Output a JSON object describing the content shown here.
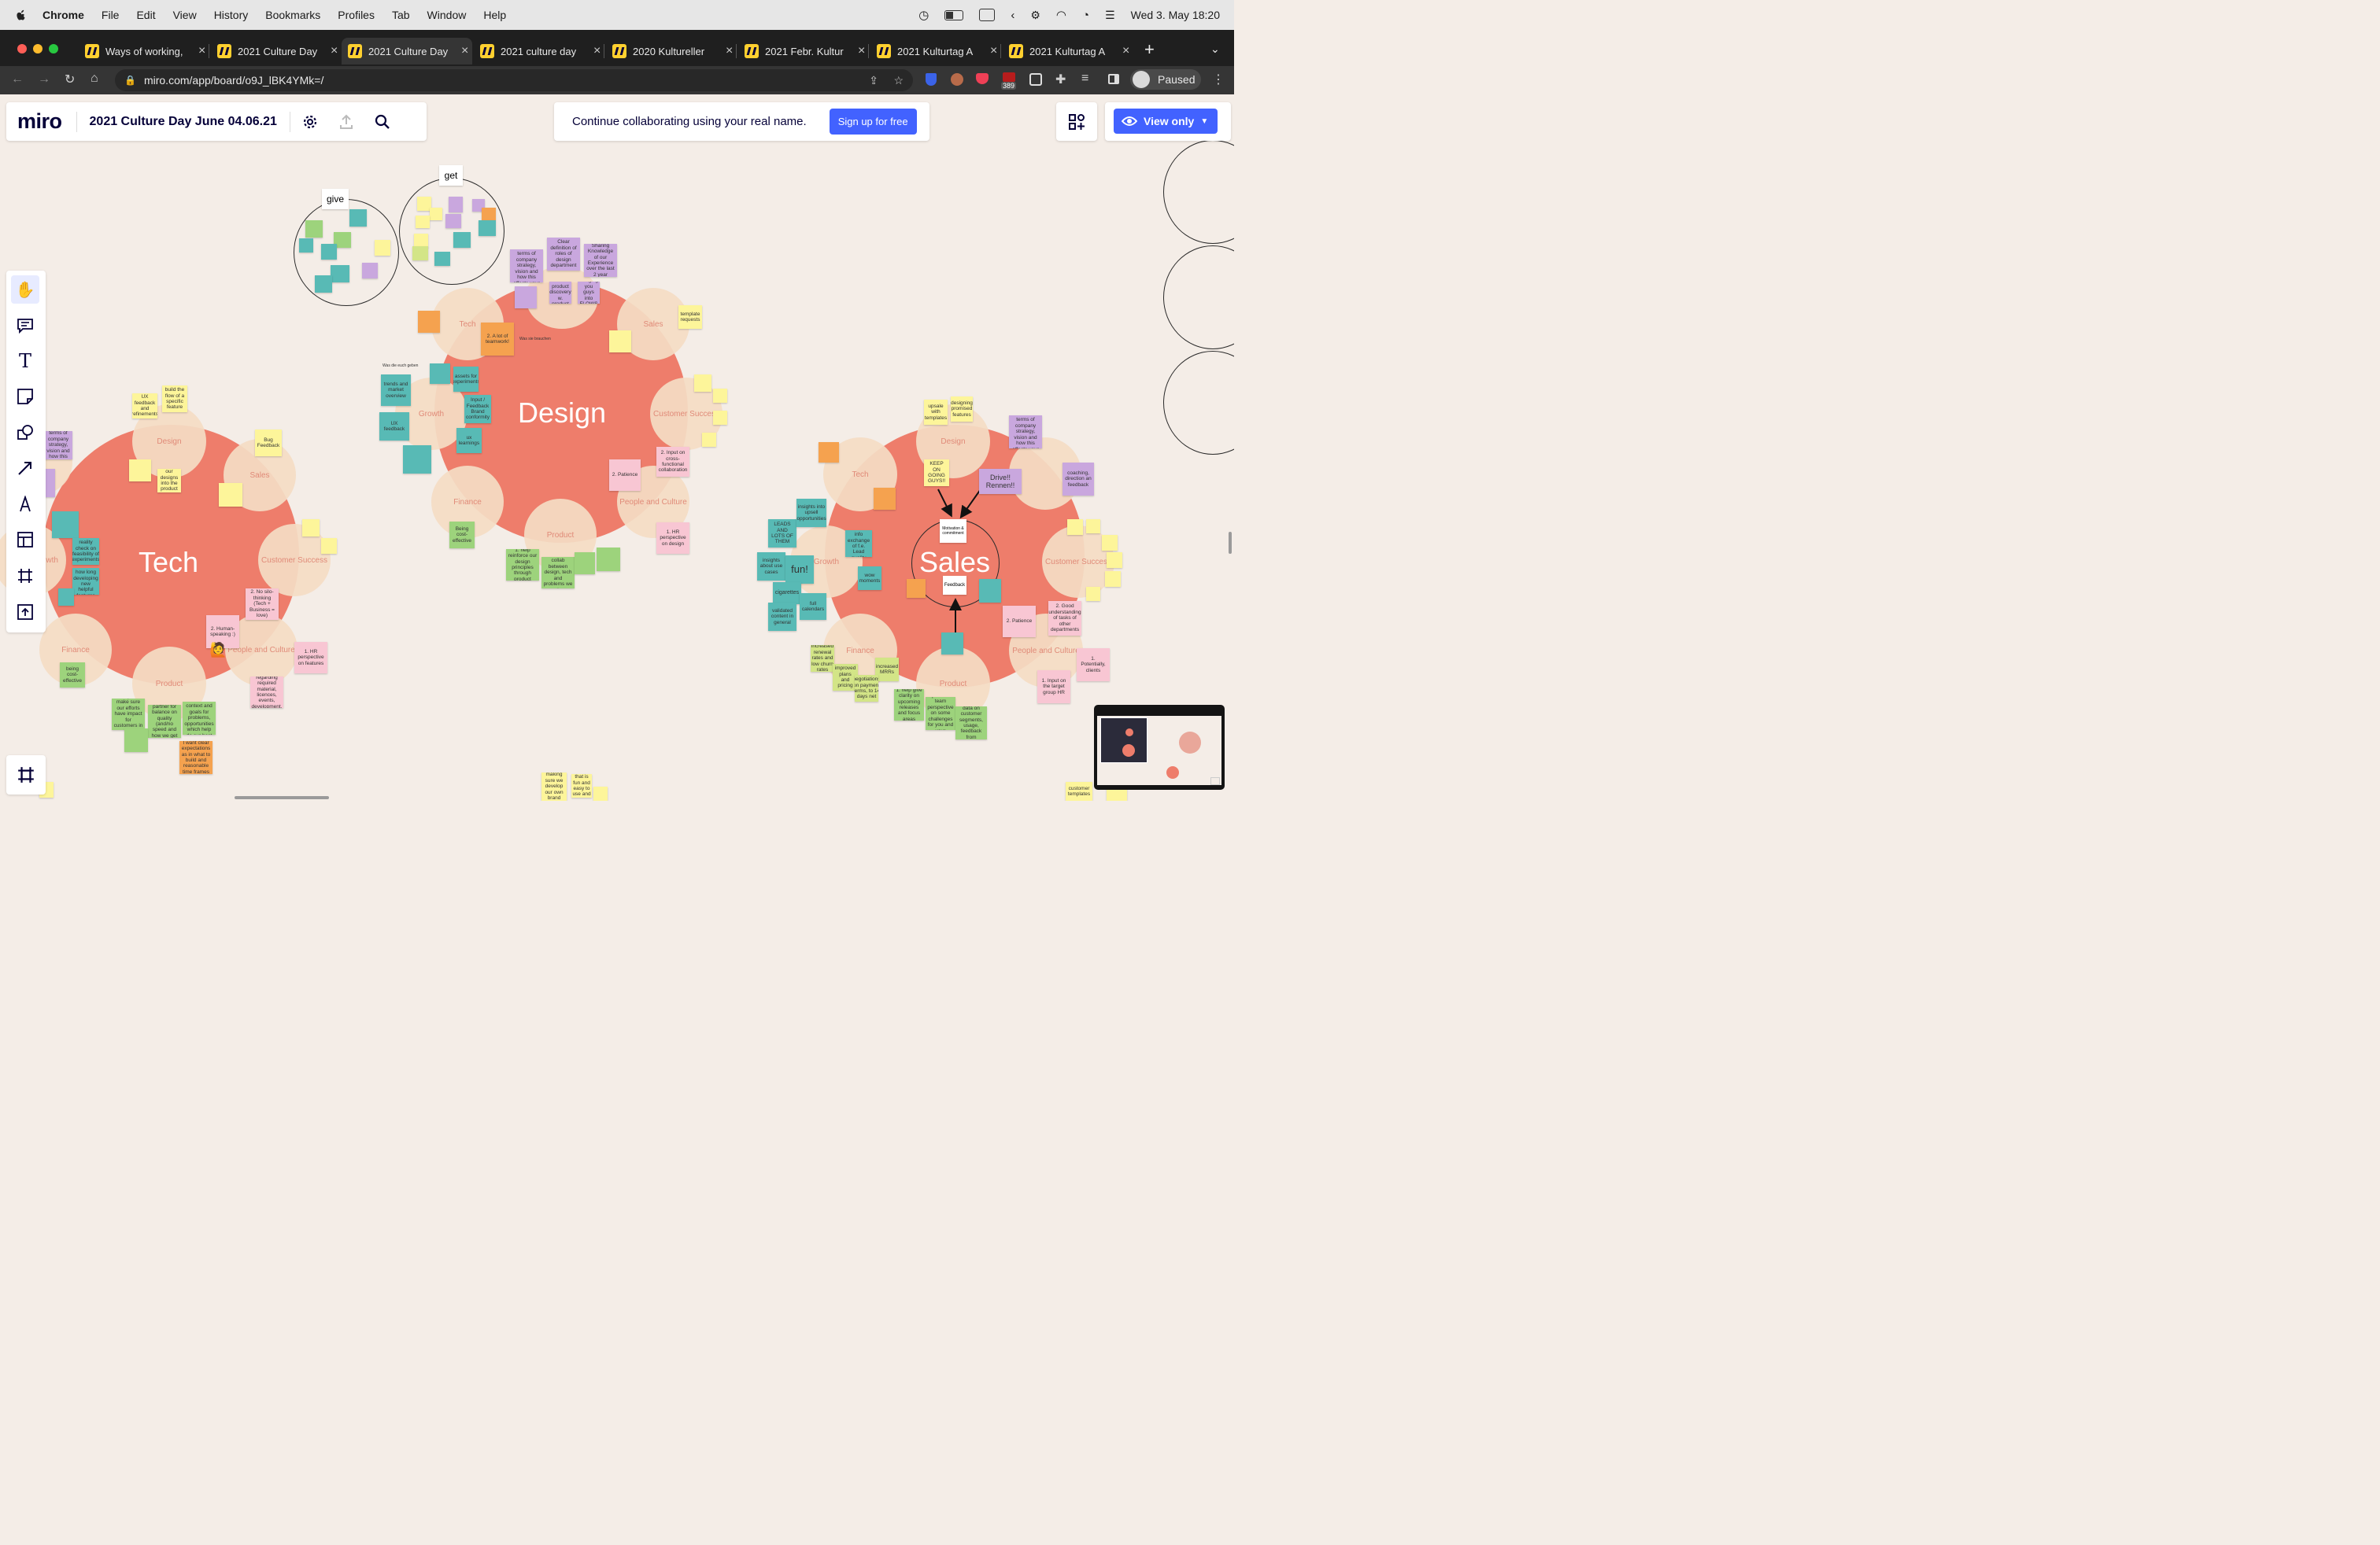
{
  "menubar": {
    "app": "Chrome",
    "items": [
      "File",
      "Edit",
      "View",
      "History",
      "Bookmarks",
      "Profiles",
      "Tab",
      "Window",
      "Help"
    ],
    "datetime": "Wed 3. May  18:20"
  },
  "tabs": [
    {
      "title": "Ways of working,"
    },
    {
      "title": "2021 Culture Day"
    },
    {
      "title": "2021 Culture Day"
    },
    {
      "title": "2021 culture day"
    },
    {
      "title": "2020 Kultureller"
    },
    {
      "title": "2021 Febr. Kultur"
    },
    {
      "title": "2021 Kulturtag A"
    },
    {
      "title": "2021 Kulturtag A"
    }
  ],
  "tab_close": "×",
  "new_tab": "+",
  "address": {
    "url": "miro.com/app/board/o9J_lBK4YMk=/"
  },
  "extensions": {
    "badge": "389",
    "profile_label": "Paused"
  },
  "miro": {
    "logo": "miro",
    "board_title": "2021 Culture Day June 04.06.21",
    "banner_text": "Continue collaborating using your real name.",
    "signup_label": "Sign up for free",
    "view_only_label": "View only"
  },
  "board": {
    "give_label": "give",
    "get_label": "get",
    "design_cluster": {
      "center": "Design",
      "petals": [
        "Tech",
        "Sales",
        "Customer Success",
        "People and Culture",
        "Product",
        "Finance",
        "Growth"
      ]
    },
    "tech_cluster": {
      "center": "Tech",
      "petals": [
        "Design",
        "Sales",
        "Customer Success",
        "People and Culture",
        "Product",
        "Finance",
        "Growth"
      ]
    },
    "sales_cluster": {
      "center": "Sales",
      "petals": [
        "Design",
        "Tech",
        "Customer Success",
        "People and Culture",
        "Product",
        "Finance",
        "Growth"
      ]
    },
    "notes_design": {
      "a_lot_teamwork": "2. A lot of teamwork!",
      "trends": "trends and market overview",
      "ux_feedback": "UX feedback",
      "patience": "2. Patience",
      "input_cross": "2. Input on cross-functional collaboration",
      "hr_design": "1. HR perspective on design",
      "being_cost": "Being cost-effective",
      "template_requests": "template requests",
      "ux_learnings": "ux learnings",
      "input_feedback": "Input / Feedback Brand conformity",
      "assets_exp": "assets for experiments",
      "clear_def": "Clear definition of roles of design department",
      "sharing": "Sharing Knowledge of our Experience over the last 2 year",
      "bringing": "Bringing you guys into FLOWS",
      "continous": "Continous product discovery w. product",
      "clear_dir": "clear direction in terms of company strategy, vision and how this affects your work",
      "help_reinforce": "1. help reinforce our design principles through product",
      "ensure_collab": "1. ensure collab between design, tech and problems we solve",
      "was_geben": "Was die euch geben",
      "was_brauchen": "Was sie brauchen"
    },
    "notes_tech": {
      "ux_feedback": "UX feedback and refinements",
      "build_flow": "build the flow of a specific feature",
      "bug_feedback": "Bug Feedback",
      "clear_dir": "clear direction in terms of company strategy, vision and how this affects your work",
      "human": "2. Human-speaking :)",
      "no_silo": "2. No silo-thinking (Tech + Business = love)",
      "hr_features": "1. HR perspective on features",
      "support": "1. Support regarding required material, licences, events, development, etc.",
      "being_cost": "being cost-effective",
      "clear_exp": "I want clear expectations as in what to build and reasonable time frames",
      "implement": "implement our designs into the product <3",
      "reality": "reality check on feasibility of experiments",
      "feedback_how": "feedback how long developing new helpful features",
      "help_tech": "1. help tech make sure our efforts have impact for customers in product",
      "sparring": "1. sparring partner for balance on quality (and/no speed and how we get best",
      "help_teams": "1. help teams clear context and goals for problems, opportunities which help do our best work"
    },
    "notes_sales": {
      "upsale": "upsale with templates",
      "designing": "designing promised features",
      "keep_going": "KEEP ON GOING GUYS!!",
      "drive": "Drive!! Rennen!!",
      "coaching": "coaching, direction an feedback",
      "motivation": "Motivation & commitment",
      "feedback": "Feedback",
      "leads": "LEADS AND LOTS OF THEM",
      "insights": "insights into upsell opportunities",
      "insights_use": "insights about use cases",
      "fun": "fun!",
      "cigarettes": "cigarettes",
      "validated": "validated content in general",
      "full_cal": "full calendars",
      "wow": "wow moments",
      "detailed": "detailed info exchange of f.e. Lead quality",
      "improved": "improved plans and pricing",
      "increased_mrr": "increased MRRs",
      "patience": "2. Patience",
      "good_under": "2. Good understanding of tasks of other departments",
      "potentially": "1. Potentially, clients",
      "input_target": "1. Input on the target group HR",
      "help_clarity": "1. help give clarity on upcoming releases and focus areas",
      "give_product": "1. give a product team perspective on some challenges for you and your customers",
      "provide_data": "1. provide data on customer segments, usage, feedback from interviews...",
      "negotiations": "negotiations on payment terms, to 14 days net",
      "increased_rev": "increased renewal rates and low churn rates",
      "cust_templates": "customer templates",
      "dc_clear": "clear direction in terms of company strategy, vision and how this affects your work"
    },
    "notes_bottom": {
      "making_sure": "making sure we develop our own brand",
      "designing_product": "designing a product that is fun and easy to use and that is up to date"
    }
  },
  "colors": {
    "blob": "#ee7d6b",
    "petal": "#f4dcc4",
    "canvas": "#f4ede7",
    "accent": "#4262ff"
  }
}
